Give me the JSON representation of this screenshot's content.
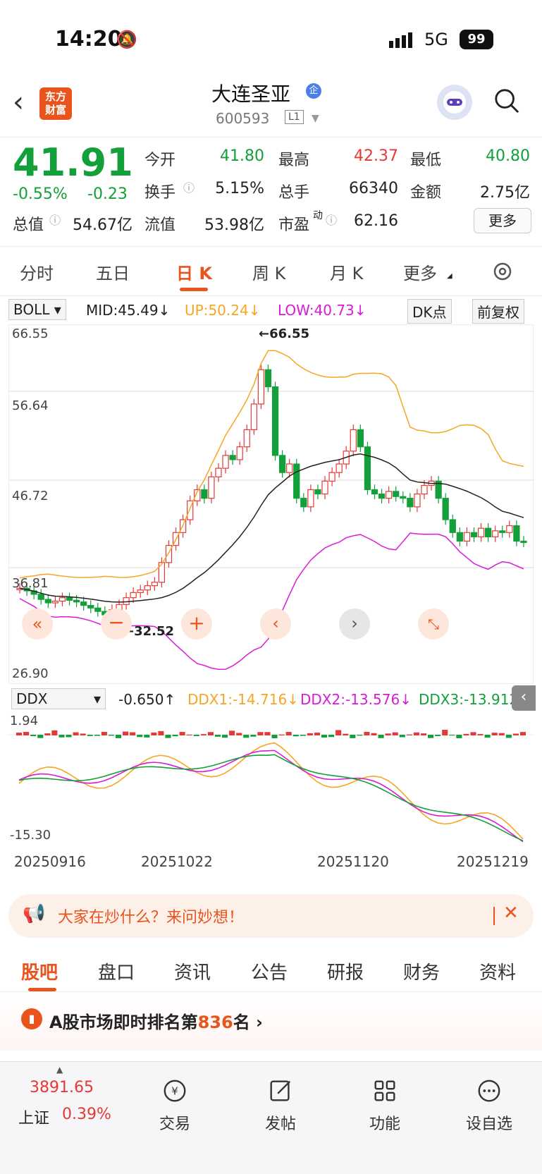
{
  "status_bar": {
    "time": "14:20",
    "network": "5G",
    "battery": "99"
  },
  "header": {
    "logo_text": "东方财富",
    "stock_name": "大连圣亚",
    "stock_code": "600593",
    "level": "L1"
  },
  "quote": {
    "price": "41.91",
    "change_pct": "-0.55%",
    "change": "-0.23",
    "open_label": "今开",
    "open": "41.80",
    "high_label": "最高",
    "high": "42.37",
    "low_label": "最低",
    "low": "40.80",
    "turnover_label": "换手",
    "turnover": "5.15%",
    "volume_label": "总手",
    "volume": "66340",
    "amount_label": "金额",
    "amount": "2.75亿",
    "total_mv_label": "总值",
    "total_mv": "54.67亿",
    "float_mv_label": "流值",
    "float_mv": "53.98亿",
    "pe_label": "市盈",
    "pe_sup": "动",
    "pe": "62.16",
    "more_label": "更多"
  },
  "period_tabs": [
    "分时",
    "五日",
    "日 K",
    "周 K",
    "月 K",
    "更多"
  ],
  "indicator": {
    "selector": "BOLL",
    "mid": "MID:45.49↓",
    "up": "UP:50.24↓",
    "low": "LOW:40.73↓",
    "dk_button": "DK点",
    "adjust_button": "前复权"
  },
  "kline_axis": {
    "y_labels": [
      "66.55",
      "56.64",
      "46.72",
      "36.81",
      "26.90"
    ],
    "max_label": "66.55",
    "min_label": "32.52"
  },
  "ddx": {
    "selector": "DDX",
    "value": "-0.650↑",
    "ddx1": "DDX1:-14.716↓",
    "ddx2": "DDX2:-13.576↓",
    "ddx3": "DDX3:-13.912",
    "y_top": "1.94",
    "y_bottom": "-15.30"
  },
  "dates": [
    "20250916",
    "20251022",
    "20251120",
    "20251219"
  ],
  "banner": {
    "text": "大家在炒什么？来问妙想！"
  },
  "bottom_tabs": [
    "股吧",
    "盘口",
    "资讯",
    "公告",
    "研报",
    "财务",
    "资料"
  ],
  "rank": {
    "prefix": "A股市场即时排名第",
    "number": "836",
    "suffix": "名"
  },
  "footer": {
    "index_value": "3891.65",
    "index_name": "上证",
    "index_change": "0.39%",
    "items": [
      "交易",
      "发帖",
      "功能",
      "设自选"
    ]
  },
  "colors": {
    "up": "#e53935",
    "down": "#13a03a",
    "accent": "#e8541c",
    "boll_up": "#f5a623",
    "boll_low": "#d81bd8"
  }
}
